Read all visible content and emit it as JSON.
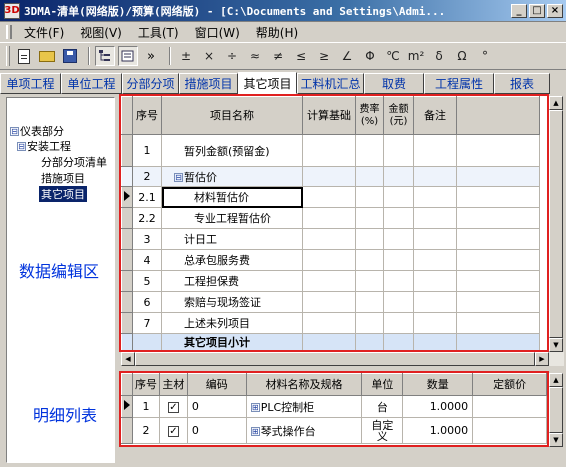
{
  "window": {
    "title": "3DMA-清单(网络版)/预算(网络版) - [C:\\Documents and Settings\\Admi...",
    "icon_label": "3D",
    "min_label": "_",
    "max_label": "□",
    "close_label": "×"
  },
  "menu": {
    "items": [
      "文件(F)",
      "视图(V)",
      "工具(T)",
      "窗口(W)",
      "帮助(H)"
    ]
  },
  "toolbar": {
    "more_label": "»",
    "symbols": [
      "±",
      "×",
      "÷",
      "≈",
      "≠",
      "≤",
      "≥",
      "∠",
      "Φ",
      "℃",
      "m²",
      "δ",
      "Ω",
      "°"
    ]
  },
  "tabs": {
    "items": [
      "单项工程",
      "单位工程",
      "分部分项",
      "措施项目",
      "其它项目",
      "工料机汇总",
      "取费",
      "工程属性",
      "报表"
    ],
    "active": "其它项目"
  },
  "tree": {
    "root": "仪表部分",
    "child": "安装工程",
    "leaves": [
      "分部分项清单",
      "措施项目",
      "其它项目"
    ],
    "selected": "其它项目",
    "collapse_symbol": "⊟"
  },
  "captions": {
    "edit_area": "数据编辑区",
    "detail_list": "明细列表"
  },
  "grid": {
    "headers": {
      "seq": "序号",
      "name": "项目名称",
      "base": "计算基础",
      "rate": "费率(%)",
      "amount": "金额(元)",
      "note": "备注"
    },
    "rows": [
      {
        "seq": "1",
        "name": "暂列金额(预留金)"
      },
      {
        "seq": "2",
        "name": "暂估价",
        "group": "⊟"
      },
      {
        "seq": "2.1",
        "name": "材料暂估价"
      },
      {
        "seq": "2.2",
        "name": "专业工程暂估价"
      },
      {
        "seq": "3",
        "name": "计日工"
      },
      {
        "seq": "4",
        "name": "总承包服务费"
      },
      {
        "seq": "5",
        "name": "工程担保费"
      },
      {
        "seq": "6",
        "name": "索赔与现场签证"
      },
      {
        "seq": "7",
        "name": "上述未列项目"
      }
    ],
    "total": "其它项目小计"
  },
  "detail": {
    "headers": {
      "seq": "序号",
      "main": "主材",
      "code": "编码",
      "name": "材料名称及规格",
      "unit": "单位",
      "qty": "数量",
      "price": "定额价"
    },
    "rows": [
      {
        "seq": "1",
        "checked": "✓",
        "code": "0",
        "name": "PLC控制柜",
        "unit": "台",
        "qty": "1.0000"
      },
      {
        "seq": "2",
        "checked": "✓",
        "code": "0",
        "name": "琴式操作台",
        "unit": "自定义",
        "qty": "1.0000"
      }
    ],
    "expand_symbol": "⊞"
  }
}
